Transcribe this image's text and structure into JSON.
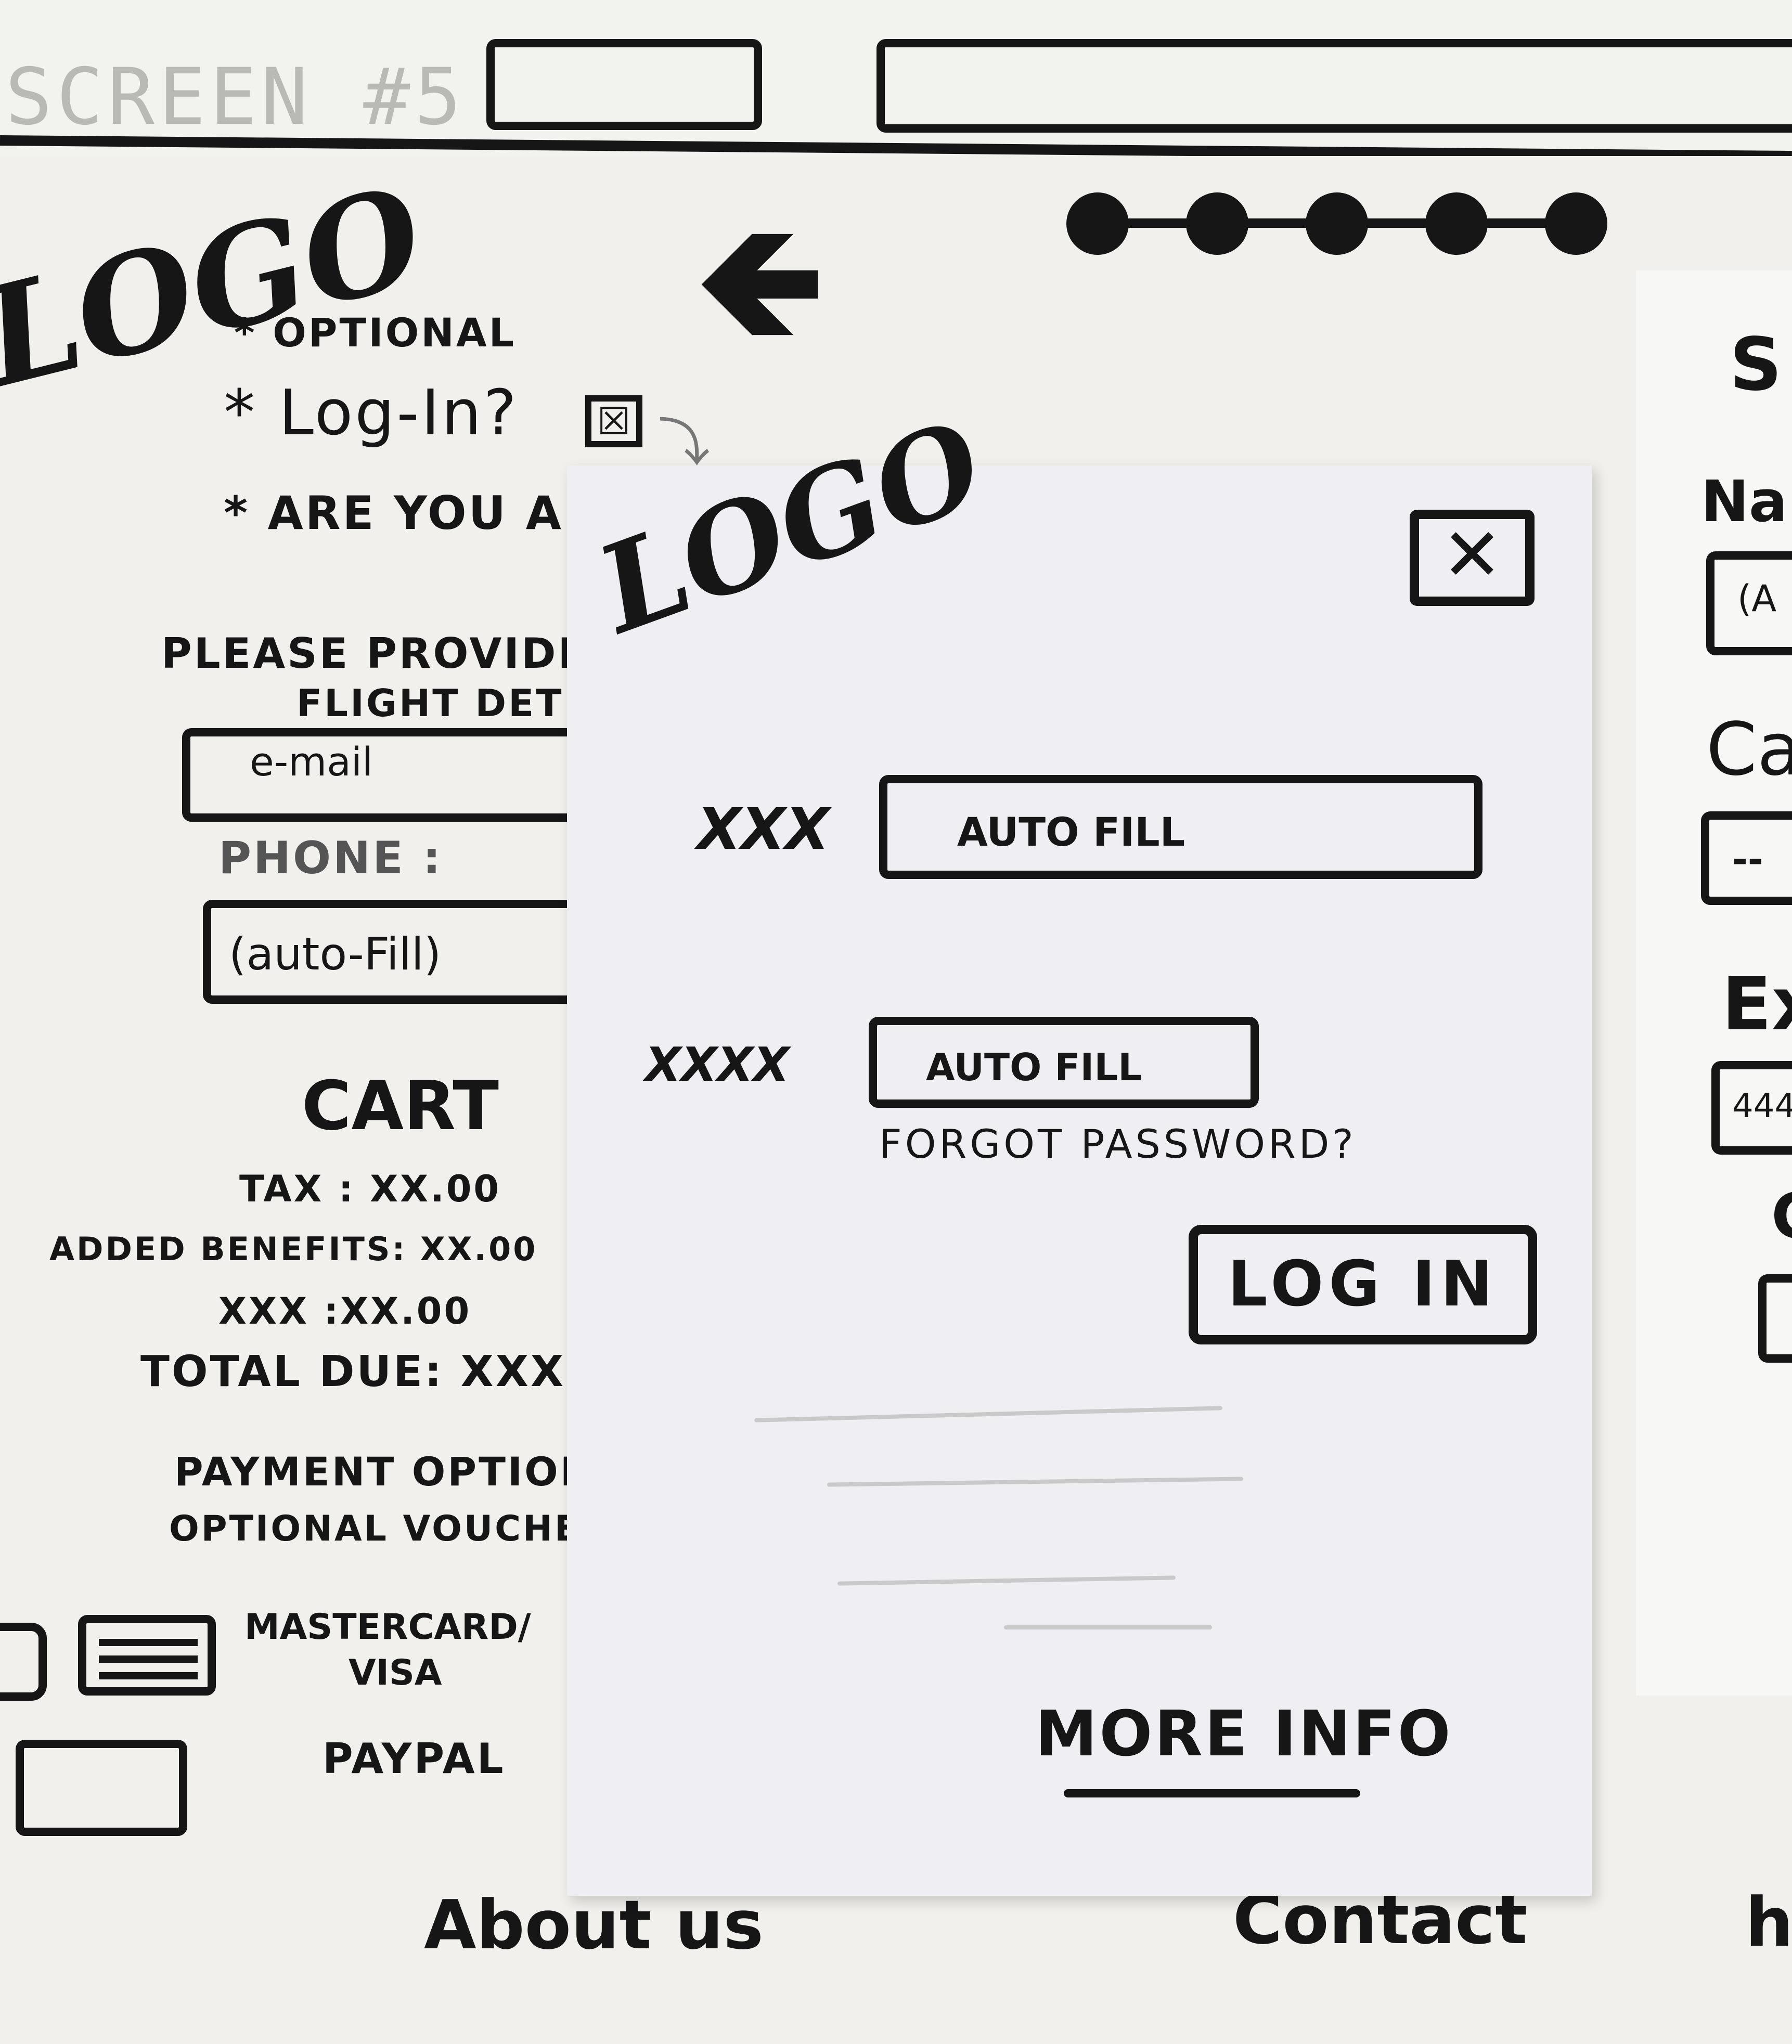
{
  "header": {
    "screen_label": "SCREEN #5"
  },
  "background_page": {
    "logo": "LOGO",
    "back_arrow_icon": "left-arrow-icon",
    "progress_steps": {
      "total": 5,
      "completed": 5
    },
    "optional_note": "* OPTIONAL",
    "login_prompt": "* Log-In?",
    "login_checkbox": "☒",
    "guest_prompt": "* ARE YOU A",
    "provide_line_1": "PLEASE PROVIDE co",
    "provide_line_2": "FLIGHT DET",
    "email_placeholder": "e-mail",
    "phone_label": "PHONE :",
    "phone_value": "(auto-Fill)",
    "cart": {
      "title": "CART",
      "tax": "TAX : XX.00",
      "added_benefits": "ADDED BENEFITS: XX.00",
      "xxx": "XXX :XX.00",
      "total_due": "TOTAL DUE: XXX.",
      "payment_options": "PAYMENT OPTIONS",
      "optional_voucher": "OPTIONAL VOUCHER",
      "mastercard_label_1": "MASTERCARD/",
      "mastercard_label_2": "VISA",
      "paypal_label": "PAYPAL"
    }
  },
  "right_page": {
    "title_fragment": "S",
    "name_fragment": "Na",
    "name_value_fragment": "(A",
    "card_fragment": "Ca",
    "card_value_fragment": "--",
    "expiry_fragment": "Ex",
    "expiry_value_fragment": "444",
    "cvc_fragment": "C"
  },
  "footer": {
    "about": "About us",
    "contact": "Contact",
    "help_fragment": "h"
  },
  "login_modal": {
    "logo": "LOGO",
    "close_icon": "close-icon",
    "close_glyph": "✕",
    "username_label": "XXX",
    "username_value": "AUTO FILL",
    "password_label": "XXXX",
    "password_value": "AUTO FILL",
    "forgot_password": "FORGOT PASSWORD?",
    "login_button": "LOG IN",
    "more_info": "MORE INFO"
  }
}
